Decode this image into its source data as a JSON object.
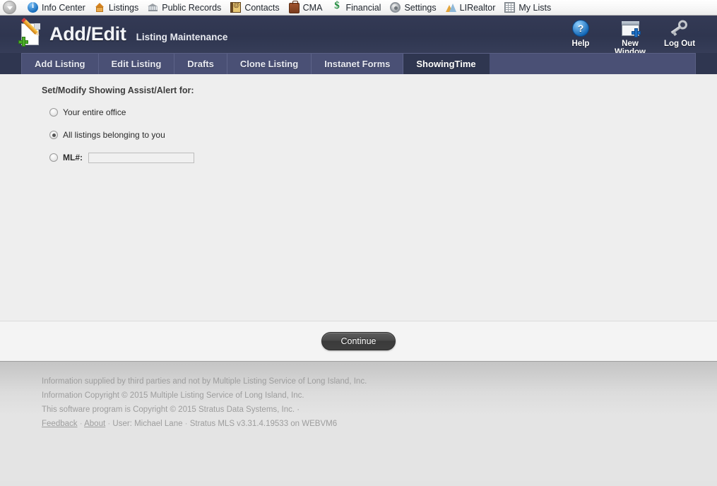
{
  "topnav": {
    "collapse_icon": "circle-chevron-down-icon",
    "items": [
      {
        "label": "Info Center",
        "icon": "info-icon"
      },
      {
        "label": "Listings",
        "icon": "house-icon"
      },
      {
        "label": "Public Records",
        "icon": "bank-icon"
      },
      {
        "label": "Contacts",
        "icon": "address-book-icon"
      },
      {
        "label": "CMA",
        "icon": "briefcase-icon"
      },
      {
        "label": "Financial",
        "icon": "dollar-icon"
      },
      {
        "label": "Settings",
        "icon": "gear-icon"
      },
      {
        "label": "LIRealtor",
        "icon": "mountains-icon"
      },
      {
        "label": "My Lists",
        "icon": "grid-icon"
      }
    ]
  },
  "header": {
    "icon": "document-pencil-add-icon",
    "title": "Add/Edit",
    "subtitle": "Listing Maintenance",
    "actions": [
      {
        "label": "Help",
        "icon": "question-circle-icon"
      },
      {
        "label": "New Window",
        "icon": "new-window-icon"
      },
      {
        "label": "Log Out",
        "icon": "key-icon"
      }
    ],
    "bg_color": "#2f3650"
  },
  "tabs": [
    {
      "label": "Add Listing",
      "active": false
    },
    {
      "label": "Edit Listing",
      "active": false
    },
    {
      "label": "Drafts",
      "active": false
    },
    {
      "label": "Clone Listing",
      "active": false
    },
    {
      "label": "Instanet Forms",
      "active": false
    },
    {
      "label": "ShowingTime",
      "active": true
    }
  ],
  "main": {
    "form_title": "Set/Modify Showing Assist/Alert for:",
    "options": [
      {
        "label": "Your entire office",
        "checked": false,
        "bold": false
      },
      {
        "label": "All listings belonging to you",
        "checked": true,
        "bold": false
      },
      {
        "label": "ML#:",
        "checked": false,
        "bold": true
      }
    ],
    "ml_input": {
      "value": "",
      "placeholder": ""
    }
  },
  "buttonbar": {
    "continue_label": "Continue"
  },
  "footer": {
    "line1": "Information supplied by third parties and not by Multiple Listing Service of Long Island, Inc.",
    "line2": "Information Copyright © 2015 Multiple Listing Service of Long Island, Inc.",
    "line3": "This software program is Copyright © 2015 Stratus Data Systems, Inc.  ·",
    "feedback_link": "Feedback",
    "about_link": "About",
    "user_text": "User: Michael Lane",
    "version_text": "Stratus MLS v3.31.4.19533 on WEBVM6",
    "sep": "·"
  }
}
